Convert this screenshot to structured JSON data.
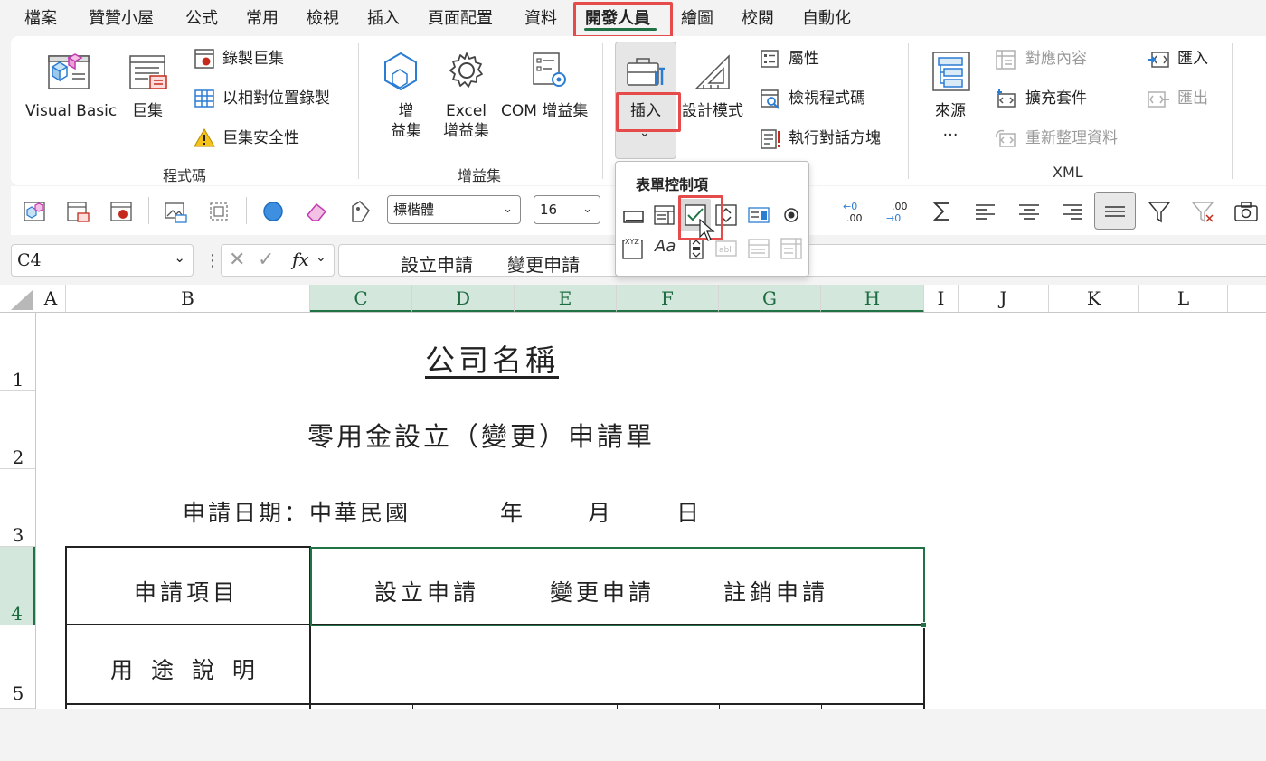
{
  "menu_tabs": [
    {
      "label": "檔案"
    },
    {
      "label": "贊贊小屋"
    },
    {
      "label": "公式"
    },
    {
      "label": "常用"
    },
    {
      "label": "檢視"
    },
    {
      "label": "插入"
    },
    {
      "label": "頁面配置"
    },
    {
      "label": "資料"
    },
    {
      "label": "開發人員",
      "active": true
    },
    {
      "label": "繪圖"
    },
    {
      "label": "校閱"
    },
    {
      "label": "自動化"
    }
  ],
  "ribbon": {
    "code_group": {
      "label": "程式碼",
      "visual_basic": "Visual Basic",
      "macros": "巨集",
      "record_macro": "錄製巨集",
      "relative_ref": "以相對位置錄製",
      "macro_security": "巨集安全性"
    },
    "addins_group": {
      "label": "增益集",
      "addins_line1": "增",
      "addins_line2": "益集",
      "excel_addins_line1": "Excel",
      "excel_addins_line2": "增益集",
      "com_addins": "COM 增益集"
    },
    "controls_group": {
      "insert": "插入",
      "design_mode": "設計模式",
      "properties": "屬性",
      "view_code": "檢視程式碼",
      "run_dialog": "執行對話方塊"
    },
    "xml_group": {
      "label": "XML",
      "source_line1": "來源",
      "source_line2": "…",
      "map_properties": "對應內容",
      "expansion_packs": "擴充套件",
      "refresh_data": "重新整理資料",
      "import": "匯入",
      "export": "匯出"
    }
  },
  "toolbar": {
    "font_name": "標楷體",
    "font_size": "16"
  },
  "form_controls_panel": {
    "title": "表單控制項",
    "label_control": "Aa",
    "groupbox_text": "XYZ",
    "textfield_text": "abl"
  },
  "formula_bar": {
    "name_box": "C4",
    "fx": "fx",
    "content": "設立申請      變更申請"
  },
  "columns": [
    "A",
    "B",
    "C",
    "D",
    "E",
    "F",
    "G",
    "H",
    "I",
    "J",
    "K",
    "L"
  ],
  "rows": [
    "1",
    "2",
    "3",
    "4",
    "5"
  ],
  "sheet": {
    "company_name": "公司名稱",
    "form_title": "零用金設立（變更）申請單",
    "date_label": "申請日期：中華民國",
    "year": "年",
    "month": "月",
    "day": "日",
    "apply_item_label": "申請項目",
    "option_setup": "設立申請",
    "option_change": "變更申請",
    "option_cancel": "註銷申請",
    "purpose_label": "用 途 說 明"
  },
  "colors": {
    "accent_green": "#217346",
    "highlight_red": "#e54b4b",
    "selected_header_bg": "#d3e7dc"
  }
}
